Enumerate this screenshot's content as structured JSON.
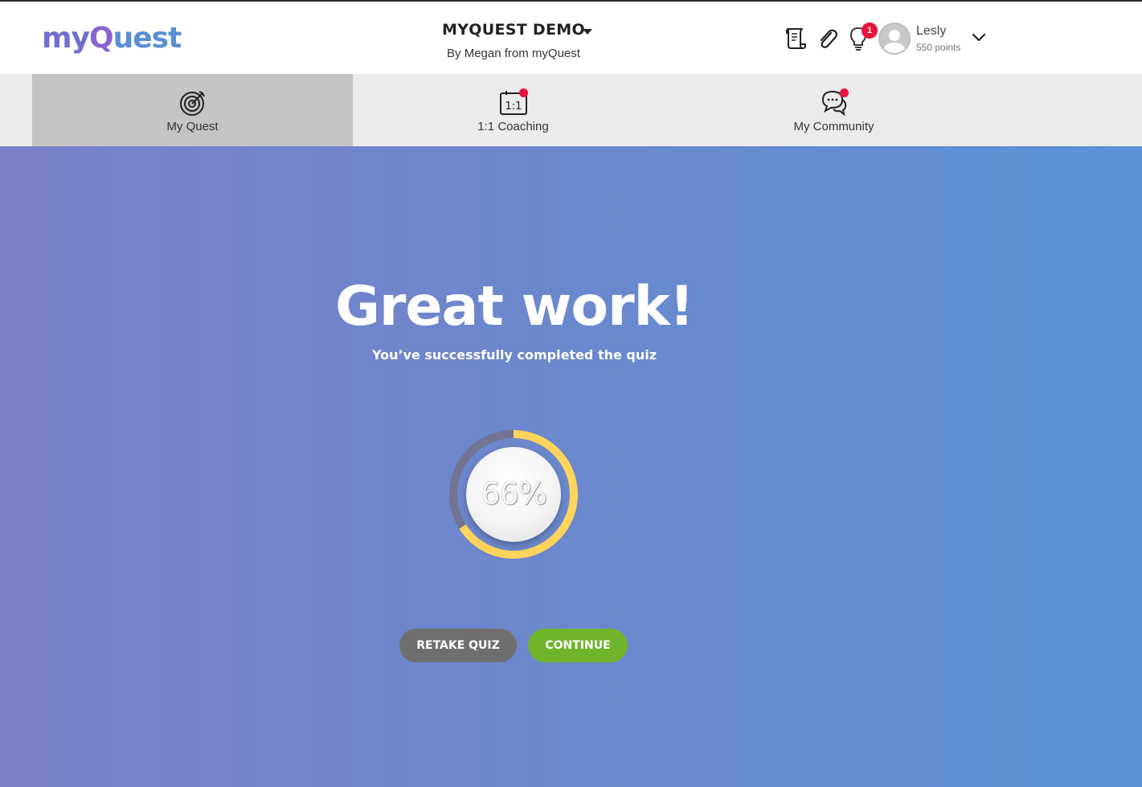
{
  "header": {
    "logo": {
      "part1": "my",
      "part2": "Q",
      "part3": "uest"
    },
    "quest_title": "MYQUEST DEMO",
    "quest_subtitle": "By Megan from myQuest",
    "icons": [
      "scroll-icon",
      "paperclip-icon",
      "lightbulb-icon"
    ],
    "notification_count": "1",
    "user": {
      "name": "Lesly",
      "points": "550 points"
    }
  },
  "nav": {
    "tabs": [
      {
        "label": "My Quest",
        "icon": "target-icon",
        "active": true
      },
      {
        "label": "1:1 Coaching",
        "icon": "coaching-icon",
        "active": false
      },
      {
        "label": "My Community",
        "icon": "chat-bubbles-icon",
        "active": false
      }
    ]
  },
  "main": {
    "headline": "Great work!",
    "subline": "You’ve successfully completed the quiz",
    "score_label": "66%",
    "score_fraction": 0.66,
    "buttons": {
      "retake": "RETAKE QUIZ",
      "continue": "CONTINUE"
    }
  },
  "colors": {
    "progress_fill": "#fdd55c",
    "progress_track": "#737393",
    "continue_button": "#6fb52c",
    "retake_button": "#6f6f6f",
    "notification": "#e8143c",
    "gradient_start": "#7a80c8",
    "gradient_end": "#5a92d4"
  }
}
